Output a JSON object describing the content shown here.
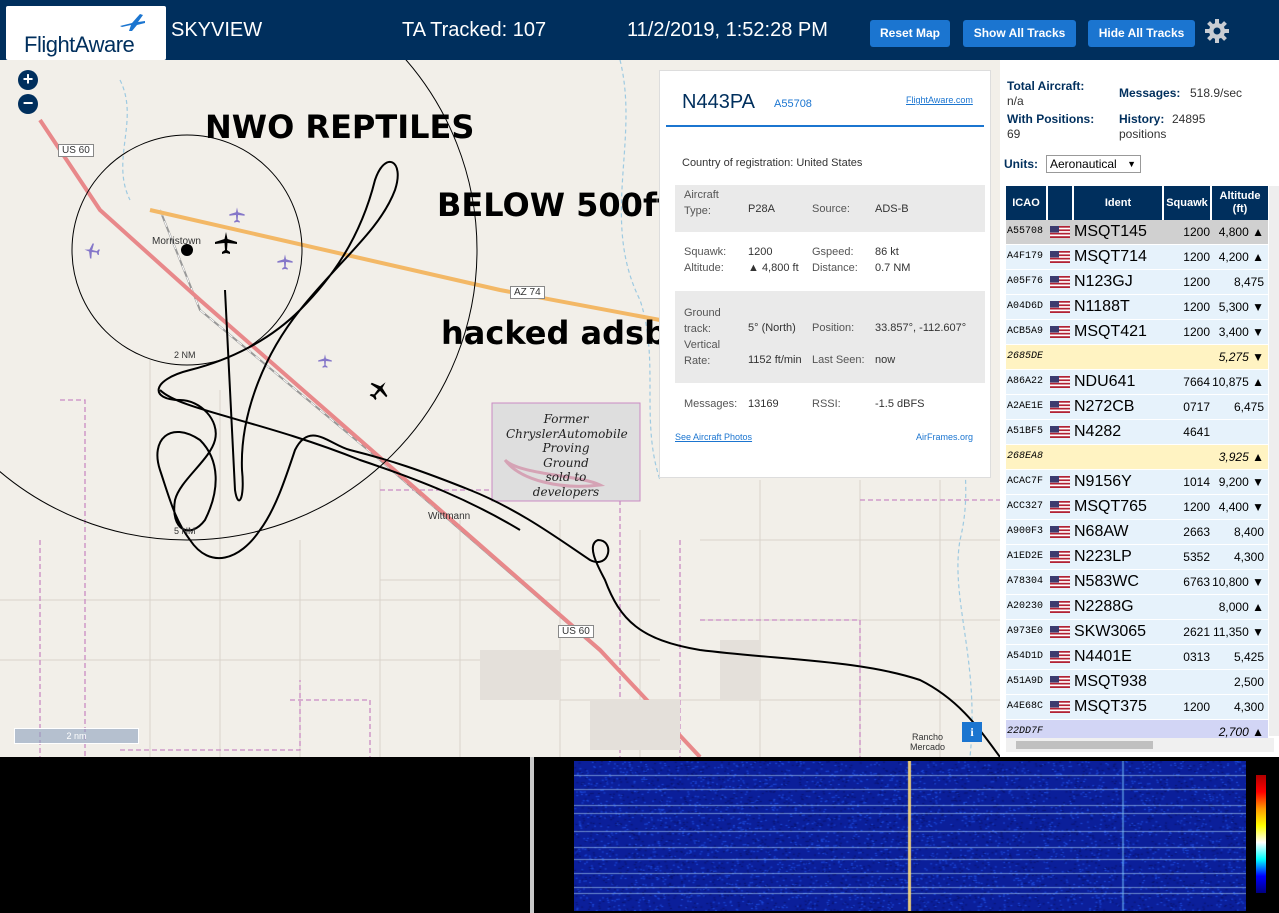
{
  "header": {
    "logo_text": "FlightAware",
    "app_name": "SKYVIEW",
    "ta_tracked": "TA Tracked: 107",
    "datetime": "11/2/2019, 1:52:28 PM",
    "buttons": {
      "reset_map": "Reset Map",
      "show_all": "Show All Tracks",
      "hide_all": "Hide All Tracks"
    }
  },
  "map": {
    "zoom_in": "+",
    "zoom_out": "−",
    "scale_label": "2 nm",
    "labels": {
      "us60_a": "US 60",
      "us60_b": "US 60",
      "az74": "AZ 74",
      "morristown": "Morristown",
      "wittmann": "Wittmann",
      "ring_2nm": "2 NM",
      "ring_5nm": "5 NM",
      "rancho": "Rancho\nMercado",
      "chrysler": "Former\nChryslerAutomobile\nProving\nGround\nsold to\ndevelopers"
    },
    "overlay": {
      "line1": "NWO REPTILES",
      "line2": "BELOW 500ft",
      "line3": "hacked adsb"
    },
    "info_btn": "i"
  },
  "popup": {
    "callsign": "N443PA",
    "hex": "A55708",
    "fa_link": "FlightAware.com",
    "country": "Country of registration: United States",
    "aircraft_type_label": "Aircraft\nType:",
    "aircraft_type": "P28A",
    "source_label": "Source:",
    "source": "ADS-B",
    "squawk_label": "Squawk:",
    "squawk": "1200",
    "gspeed_label": "Gspeed:",
    "gspeed": "86 kt",
    "altitude_label": "Altitude:",
    "altitude": "▲ 4,800 ft",
    "distance_label": "Distance:",
    "distance": "0.7 NM",
    "ground_track_label": "Ground\ntrack:",
    "ground_track": "5° (North)",
    "position_label": "Position:",
    "position": "33.857°, -112.607°",
    "vrate_label": "Vertical\nRate:",
    "vrate": "1152 ft/min",
    "last_seen_label": "Last Seen:",
    "last_seen": "now",
    "messages_label": "Messages:",
    "messages": "13169",
    "rssi_label": "RSSI:",
    "rssi": "-1.5 dBFS",
    "photos_link": "See Aircraft Photos",
    "airframes_link": "AirFrames.org"
  },
  "panel": {
    "total_aircraft_label": "Total Aircraft:",
    "total_aircraft": "n/a",
    "messages_label": "Messages:",
    "messages": "518.9/sec",
    "with_positions_label": "With Positions:",
    "with_positions": "69",
    "history_label": "History:",
    "history": "24895",
    "history_unit": "positions",
    "units_label": "Units:",
    "units_value": "Aeronautical",
    "columns": [
      "ICAO",
      "Ident",
      "Squawk",
      "Altitude\n(ft)"
    ],
    "rows": [
      {
        "icao": "A55708",
        "ident": "MSQT145",
        "squawk": "1200",
        "alt": "4,800 ▲",
        "flag": true,
        "style": "selected"
      },
      {
        "icao": "A4F179",
        "ident": "MSQT714",
        "squawk": "1200",
        "alt": "4,200 ▲",
        "flag": true,
        "style": "normal"
      },
      {
        "icao": "A05F76",
        "ident": "N123GJ",
        "squawk": "1200",
        "alt": "8,475",
        "flag": true,
        "style": "normal"
      },
      {
        "icao": "A04D6D",
        "ident": "N1188T",
        "squawk": "1200",
        "alt": "5,300 ▼",
        "flag": true,
        "style": "normal"
      },
      {
        "icao": "ACB5A9",
        "ident": "MSQT421",
        "squawk": "1200",
        "alt": "3,400 ▼",
        "flag": true,
        "style": "normal"
      },
      {
        "icao": "2685DE",
        "ident": "",
        "squawk": "",
        "alt": "5,275 ▼",
        "flag": false,
        "style": "mlat"
      },
      {
        "icao": "A86A22",
        "ident": "NDU641",
        "squawk": "7664",
        "alt": "10,875 ▲",
        "flag": true,
        "style": "normal"
      },
      {
        "icao": "A2AE1E",
        "ident": "N272CB",
        "squawk": "0717",
        "alt": "6,475",
        "flag": true,
        "style": "normal"
      },
      {
        "icao": "A51BF5",
        "ident": "N4282",
        "squawk": "4641",
        "alt": "",
        "flag": true,
        "style": "normal"
      },
      {
        "icao": "268EA8",
        "ident": "",
        "squawk": "",
        "alt": "3,925 ▲",
        "flag": false,
        "style": "mlat"
      },
      {
        "icao": "ACAC7F",
        "ident": "N9156Y",
        "squawk": "1014",
        "alt": "9,200 ▼",
        "flag": true,
        "style": "normal"
      },
      {
        "icao": "ACC327",
        "ident": "MSQT765",
        "squawk": "1200",
        "alt": "4,400 ▼",
        "flag": true,
        "style": "normal"
      },
      {
        "icao": "A900F3",
        "ident": "N68AW",
        "squawk": "2663",
        "alt": "8,400",
        "flag": true,
        "style": "normal"
      },
      {
        "icao": "A1ED2E",
        "ident": "N223LP",
        "squawk": "5352",
        "alt": "4,300",
        "flag": true,
        "style": "normal"
      },
      {
        "icao": "A78304",
        "ident": "N583WC",
        "squawk": "6763",
        "alt": "10,800 ▼",
        "flag": true,
        "style": "normal"
      },
      {
        "icao": "A20230",
        "ident": "N2288G",
        "squawk": "",
        "alt": "8,000 ▲",
        "flag": true,
        "style": "normal"
      },
      {
        "icao": "A973E0",
        "ident": "SKW3065",
        "squawk": "2621",
        "alt": "11,350 ▼",
        "flag": true,
        "style": "normal"
      },
      {
        "icao": "A54D1D",
        "ident": "N4401E",
        "squawk": "0313",
        "alt": "5,425",
        "flag": true,
        "style": "normal"
      },
      {
        "icao": "A51A9D",
        "ident": "MSQT938",
        "squawk": "",
        "alt": "2,500",
        "flag": true,
        "style": "normal"
      },
      {
        "icao": "A4E68C",
        "ident": "MSQT375",
        "squawk": "1200",
        "alt": "4,300",
        "flag": true,
        "style": "normal"
      },
      {
        "icao": "22DD7F",
        "ident": "",
        "squawk": "",
        "alt": "2,700 ▲",
        "flag": false,
        "style": "tisb"
      }
    ]
  },
  "colors": {
    "header_bg": "#002f5d",
    "button_blue": "#1b75d0",
    "row_light": "#e6f2fb",
    "row_selected": "#d0d0d0",
    "row_mlat": "#fff3c2",
    "row_tisb": "#d2d5f5"
  },
  "icons": [
    "flightaware-logo",
    "gear-icon",
    "plane-icon",
    "zoom-in-icon",
    "zoom-out-icon",
    "info-icon",
    "us-flag-icon"
  ]
}
